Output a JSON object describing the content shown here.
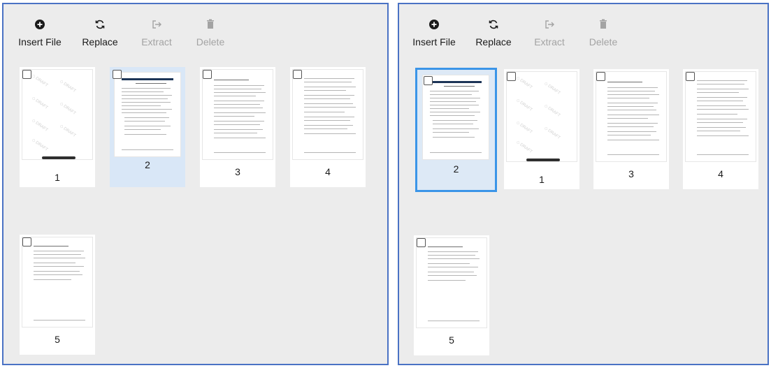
{
  "toolbar": {
    "insert_label": "Insert File",
    "replace_label": "Replace",
    "extract_label": "Extract",
    "delete_label": "Delete"
  },
  "icons": {
    "insert": "plus-circle-icon",
    "replace": "refresh-icon",
    "extract": "export-icon",
    "delete": "trash-icon"
  },
  "left_panel": {
    "pages": [
      "1",
      "2",
      "3",
      "4",
      "5"
    ],
    "selected_page": "2"
  },
  "right_panel": {
    "pages": [
      "2",
      "1",
      "3",
      "4",
      "5"
    ],
    "selected_page": "2"
  },
  "colors": {
    "panel_border": "#4a72c4",
    "selection_light": "#d9e7f7",
    "selection_strong": "#3b95e8",
    "disabled_text": "#a3a3a3"
  }
}
